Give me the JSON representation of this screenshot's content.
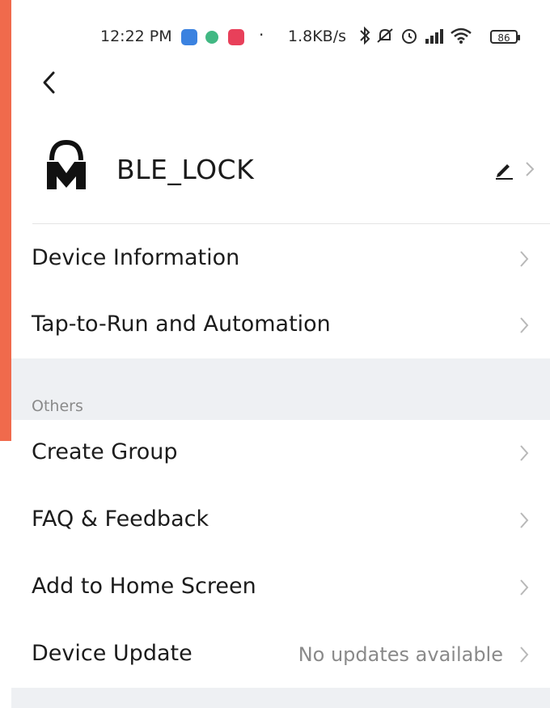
{
  "status_bar": {
    "time": "12:22 PM",
    "dot": "·",
    "network_speed": "1.8KB/s",
    "battery": "86",
    "icons": [
      "app-icon-blue",
      "app-icon-green",
      "app-icon-red",
      "bluetooth-icon",
      "mute-icon",
      "alarm-icon",
      "signal-icon",
      "wifi-icon",
      "battery-icon"
    ]
  },
  "header": {
    "device_name": "BLE_LOCK"
  },
  "main_rows": [
    {
      "label": "Device Information"
    },
    {
      "label": "Tap-to-Run and Automation"
    }
  ],
  "others": {
    "title": "Others",
    "rows": [
      {
        "label": "Create Group"
      },
      {
        "label": "FAQ & Feedback"
      },
      {
        "label": "Add to Home Screen"
      },
      {
        "label": "Device Update",
        "value": "No updates available"
      }
    ]
  },
  "colors": {
    "backdrop": "#f06a4c",
    "section_bg": "#eef0f3",
    "text": "#1c1c1c",
    "muted": "#8a8a8a"
  }
}
